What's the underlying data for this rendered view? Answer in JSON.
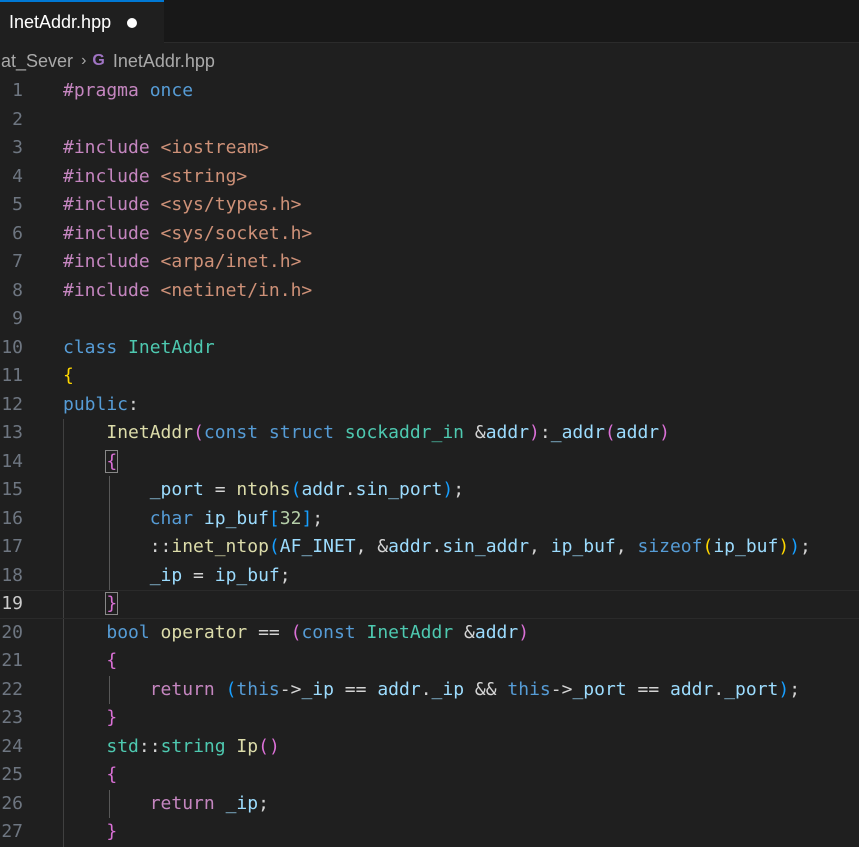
{
  "tab": {
    "filename": "InetAddr.hpp"
  },
  "breadcrumb": {
    "folder": "hat_Sever",
    "file": "InetAddr.hpp",
    "file_icon": "cpp-file-icon"
  },
  "editor": {
    "active_line": 19,
    "line_numbers": [
      "1",
      "2",
      "3",
      "4",
      "5",
      "6",
      "7",
      "8",
      "9",
      "10",
      "11",
      "12",
      "13",
      "14",
      "15",
      "16",
      "17",
      "18",
      "19",
      "20",
      "21",
      "22",
      "23",
      "24",
      "25",
      "26",
      "27"
    ],
    "lines": [
      [
        [
          "kw-pre",
          "#pragma "
        ],
        [
          "kw",
          "once"
        ]
      ],
      [],
      [
        [
          "kw-pre",
          "#include "
        ],
        [
          "inc",
          "<iostream>"
        ]
      ],
      [
        [
          "kw-pre",
          "#include "
        ],
        [
          "inc",
          "<string>"
        ]
      ],
      [
        [
          "kw-pre",
          "#include "
        ],
        [
          "inc",
          "<sys/types.h>"
        ]
      ],
      [
        [
          "kw-pre",
          "#include "
        ],
        [
          "inc",
          "<sys/socket.h>"
        ]
      ],
      [
        [
          "kw-pre",
          "#include "
        ],
        [
          "inc",
          "<arpa/inet.h>"
        ]
      ],
      [
        [
          "kw-pre",
          "#include "
        ],
        [
          "inc",
          "<netinet/in.h>"
        ]
      ],
      [],
      [
        [
          "kw",
          "class "
        ],
        [
          "type",
          "InetAddr"
        ]
      ],
      [
        [
          "b1",
          "{"
        ]
      ],
      [
        [
          "kw",
          "public"
        ],
        [
          "plain",
          ":"
        ]
      ],
      [
        [
          "plain",
          "    "
        ],
        [
          "fn",
          "InetAddr"
        ],
        [
          "b2",
          "("
        ],
        [
          "kw",
          "const struct "
        ],
        [
          "type",
          "sockaddr_in "
        ],
        [
          "plain",
          "&"
        ],
        [
          "var",
          "addr"
        ],
        [
          "b2",
          ")"
        ],
        [
          "plain",
          ":"
        ],
        [
          "var",
          "_addr"
        ],
        [
          "b2",
          "("
        ],
        [
          "var",
          "addr"
        ],
        [
          "b2",
          ")"
        ]
      ],
      [
        [
          "plain",
          "    "
        ],
        [
          "b2",
          "{"
        ]
      ],
      [
        [
          "plain",
          "        "
        ],
        [
          "var",
          "_port"
        ],
        [
          "plain",
          " = "
        ],
        [
          "fn",
          "ntohs"
        ],
        [
          "b3",
          "("
        ],
        [
          "var",
          "addr"
        ],
        [
          "plain",
          "."
        ],
        [
          "var",
          "sin_port"
        ],
        [
          "b3",
          ")"
        ],
        [
          "plain",
          ";"
        ]
      ],
      [
        [
          "plain",
          "        "
        ],
        [
          "kw",
          "char "
        ],
        [
          "var",
          "ip_buf"
        ],
        [
          "b3",
          "["
        ],
        [
          "num",
          "32"
        ],
        [
          "b3",
          "]"
        ],
        [
          "plain",
          ";"
        ]
      ],
      [
        [
          "plain",
          "        ::"
        ],
        [
          "fn",
          "inet_ntop"
        ],
        [
          "b3",
          "("
        ],
        [
          "var",
          "AF_INET"
        ],
        [
          "plain",
          ", &"
        ],
        [
          "var",
          "addr"
        ],
        [
          "plain",
          "."
        ],
        [
          "var",
          "sin_addr"
        ],
        [
          "plain",
          ", "
        ],
        [
          "var",
          "ip_buf"
        ],
        [
          "plain",
          ", "
        ],
        [
          "kw",
          "sizeof"
        ],
        [
          "b1",
          "("
        ],
        [
          "var",
          "ip_buf"
        ],
        [
          "b1",
          ")"
        ],
        [
          "b3",
          ")"
        ],
        [
          "plain",
          ";"
        ]
      ],
      [
        [
          "plain",
          "        "
        ],
        [
          "var",
          "_ip"
        ],
        [
          "plain",
          " = "
        ],
        [
          "var",
          "ip_buf"
        ],
        [
          "plain",
          ";"
        ]
      ],
      [
        [
          "plain",
          "    "
        ],
        [
          "b2",
          "}"
        ]
      ],
      [
        [
          "plain",
          "    "
        ],
        [
          "kw",
          "bool "
        ],
        [
          "fn",
          "operator "
        ],
        [
          "plain",
          "== "
        ],
        [
          "b2",
          "("
        ],
        [
          "kw",
          "const "
        ],
        [
          "type",
          "InetAddr "
        ],
        [
          "plain",
          "&"
        ],
        [
          "var",
          "addr"
        ],
        [
          "b2",
          ")"
        ]
      ],
      [
        [
          "plain",
          "    "
        ],
        [
          "b2",
          "{"
        ]
      ],
      [
        [
          "plain",
          "        "
        ],
        [
          "ctrl",
          "return "
        ],
        [
          "b3",
          "("
        ],
        [
          "kw",
          "this"
        ],
        [
          "plain",
          "->"
        ],
        [
          "var",
          "_ip"
        ],
        [
          "plain",
          " == "
        ],
        [
          "var",
          "addr"
        ],
        [
          "plain",
          "."
        ],
        [
          "var",
          "_ip"
        ],
        [
          "plain",
          " && "
        ],
        [
          "kw",
          "this"
        ],
        [
          "plain",
          "->"
        ],
        [
          "var",
          "_port"
        ],
        [
          "plain",
          " == "
        ],
        [
          "var",
          "addr"
        ],
        [
          "plain",
          "."
        ],
        [
          "var",
          "_port"
        ],
        [
          "b3",
          ")"
        ],
        [
          "plain",
          ";"
        ]
      ],
      [
        [
          "plain",
          "    "
        ],
        [
          "b2",
          "}"
        ]
      ],
      [
        [
          "plain",
          "    "
        ],
        [
          "type",
          "std"
        ],
        [
          "plain",
          "::"
        ],
        [
          "type",
          "string "
        ],
        [
          "fn",
          "Ip"
        ],
        [
          "b2",
          "()"
        ]
      ],
      [
        [
          "plain",
          "    "
        ],
        [
          "b2",
          "{"
        ]
      ],
      [
        [
          "plain",
          "        "
        ],
        [
          "ctrl",
          "return "
        ],
        [
          "var",
          "_ip"
        ],
        [
          "plain",
          ";"
        ]
      ],
      [
        [
          "plain",
          "    "
        ],
        [
          "b2",
          "}"
        ]
      ]
    ]
  }
}
